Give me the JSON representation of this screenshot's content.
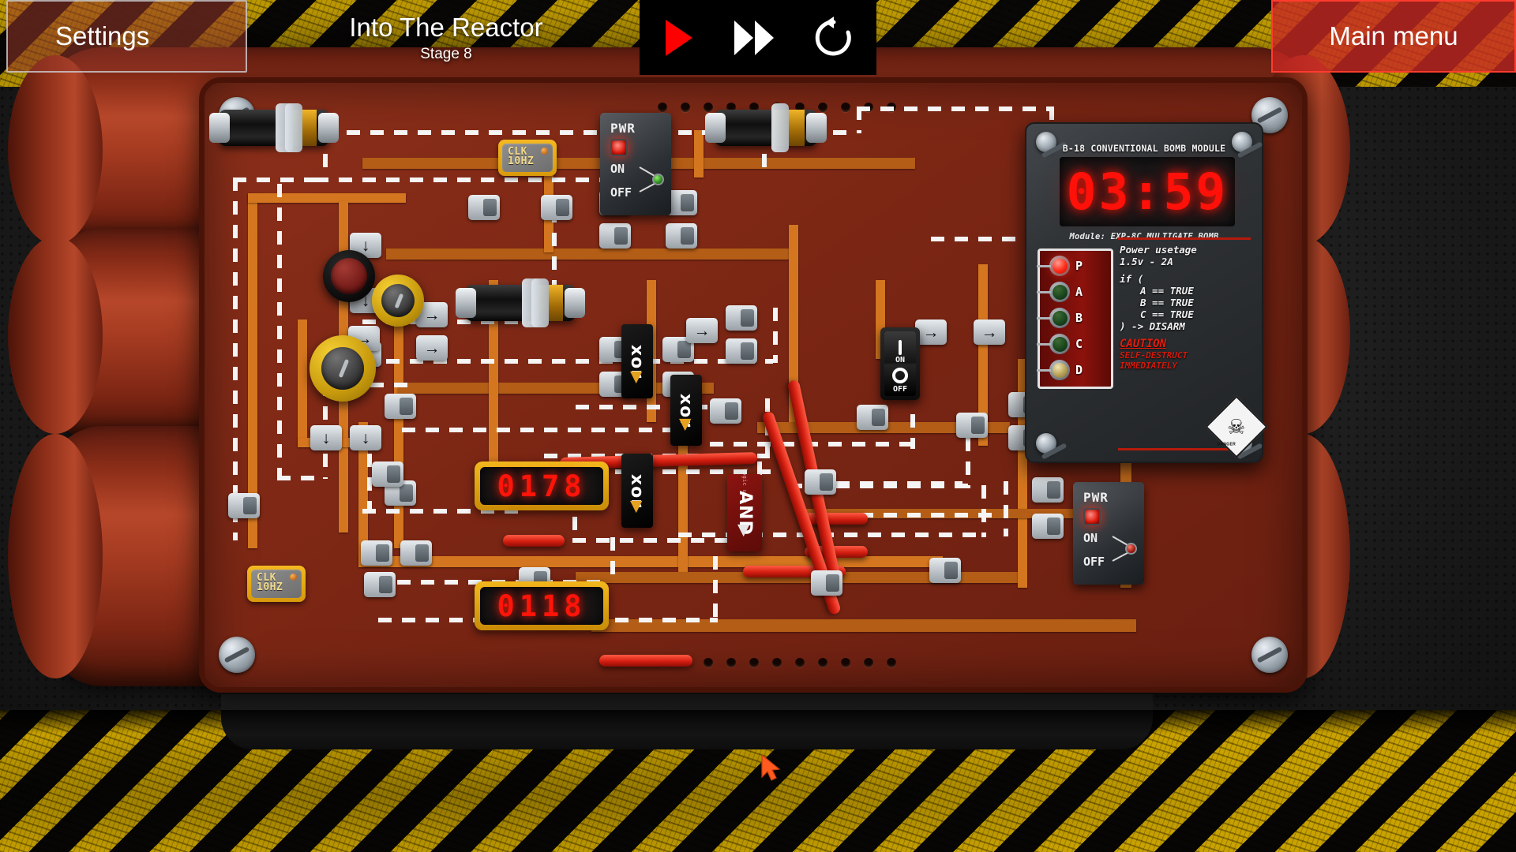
{
  "topbar": {
    "settings_label": "Settings",
    "title": "Into The Reactor",
    "stage": "Stage 8",
    "main_menu_label": "Main menu",
    "controls": [
      {
        "name": "play-button",
        "icon": "play-icon",
        "color": "#ff0000"
      },
      {
        "name": "fast-forward-button",
        "icon": "fast-forward-icon",
        "color": "#ffffff"
      },
      {
        "name": "restart-button",
        "icon": "restart-icon",
        "color": "#ffffff"
      }
    ]
  },
  "module": {
    "title": "B-18 CONVENTIONAL BOMB MODULE",
    "timer": "03:59",
    "subtitle": "Module: EXP-8C MULTIGATE BOMB",
    "leds": [
      {
        "label": "P",
        "state": "on_red"
      },
      {
        "label": "A",
        "state": "off_grn"
      },
      {
        "label": "B",
        "state": "off_grn"
      },
      {
        "label": "C",
        "state": "off_grn"
      },
      {
        "label": "D",
        "state": "dim_ylw"
      }
    ],
    "instructions": [
      "Power usetage",
      "1.5v - 2A",
      "if (",
      "A == TRUE",
      "B == TRUE",
      "C == TRUE",
      ") -> DISARM"
    ],
    "caution_title": "CAUTION",
    "caution_body_1": "SELF-DESTRUCT",
    "caution_body_2": "IMMEDIATELY",
    "hazard_label": "DANGER",
    "skull_icon": "skull-and-crossbones-icon"
  },
  "board": {
    "displays": [
      {
        "name": "seven-segment-display-upper",
        "value": "0178"
      },
      {
        "name": "seven-segment-display-lower",
        "value": "0118"
      }
    ],
    "chips": [
      {
        "name": "clock-chip-upper",
        "line1": "CLK",
        "line2": "10HZ"
      },
      {
        "name": "clock-chip-lower",
        "line1": "CLK",
        "line2": "10HZ"
      }
    ],
    "gates": [
      {
        "name": "xor-gate-1",
        "label": "xor",
        "type": "xor"
      },
      {
        "name": "xor-gate-2",
        "label": "xor",
        "type": "xor"
      },
      {
        "name": "xor-gate-3",
        "label": "xor",
        "type": "xor"
      },
      {
        "name": "and-gate-1",
        "label": "AND",
        "type": "and",
        "sub": "logic unit"
      }
    ],
    "power_switches": [
      {
        "name": "power-switch-upper",
        "title": "PWR",
        "on_label": "ON",
        "off_label": "OFF",
        "position": "OFF",
        "led": "red"
      },
      {
        "name": "power-switch-lower",
        "title": "PWR",
        "on_label": "ON",
        "off_label": "OFF",
        "position": "ON",
        "led": "red"
      }
    ],
    "rocker": {
      "name": "rocker-switch",
      "on_label": "ON",
      "off_label": "OFF"
    },
    "push_button": {
      "name": "red-push-button"
    },
    "potentiometers": [
      {
        "name": "potentiometer-yellow-left"
      },
      {
        "name": "potentiometer-yellow-mid"
      }
    ],
    "pad_arrow": "→",
    "pad_arrow_down": "↓"
  },
  "colors": {
    "accent_red": "#ff1008",
    "board_copper": "#d4761f",
    "board_base": "#7b2614",
    "hazard_yellow": "#c9a200",
    "wire_red": "#d41e10",
    "cursor": "#ff5a1f"
  }
}
